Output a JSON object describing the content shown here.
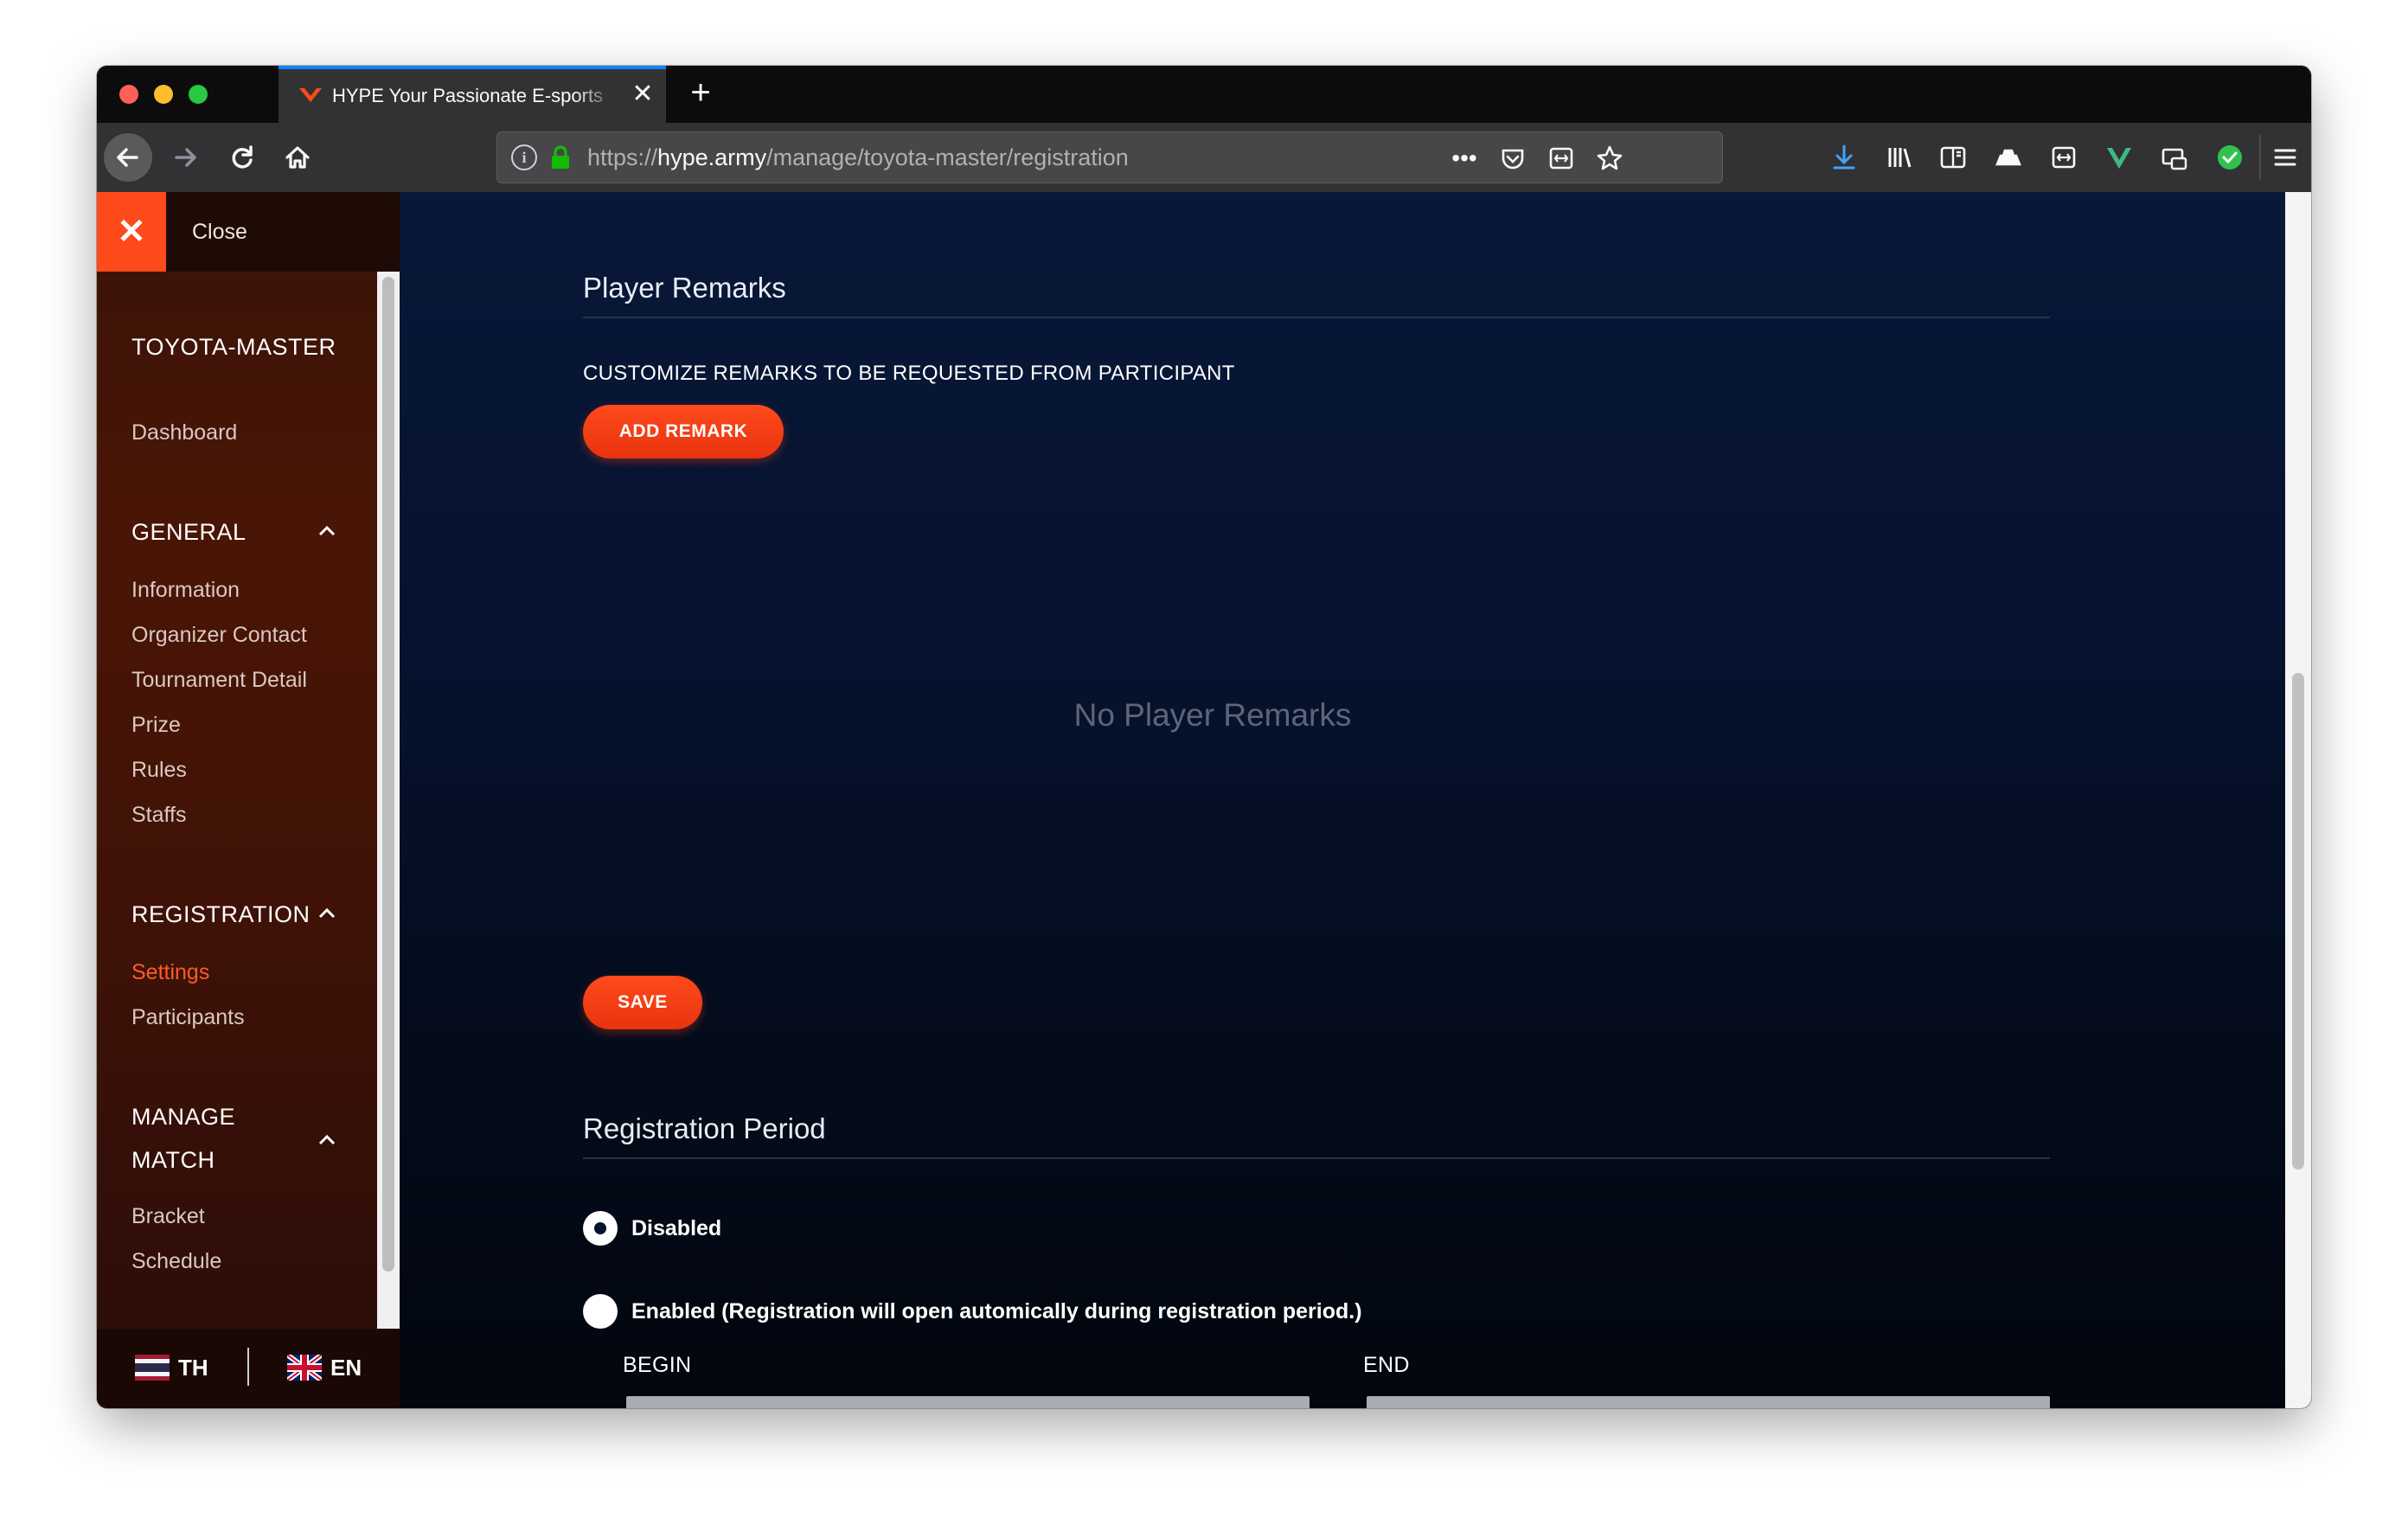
{
  "browser": {
    "tab_title": "HYPE Your Passionate E-sports",
    "url_scheme": "https://",
    "url_host": "hype.army",
    "url_path": "/manage/toyota-master/registration",
    "toolbar_icons": [
      "download-icon",
      "library-icon",
      "sidebar-icon",
      "extension-icon",
      "screenshot-icon",
      "vue-devtools-icon",
      "inbox-icon",
      "check-icon",
      "menu-icon"
    ]
  },
  "sidebar": {
    "close_label": "Close",
    "project_title": "TOYOTA-MASTER",
    "dashboard": "Dashboard",
    "general": {
      "heading": "GENERAL",
      "items": [
        "Information",
        "Organizer Contact",
        "Tournament Detail",
        "Prize",
        "Rules",
        "Staffs"
      ]
    },
    "registration": {
      "heading": "REGISTRATION",
      "items": [
        "Settings",
        "Participants"
      ],
      "active_item": "Settings"
    },
    "manage_match": {
      "heading_line1": "MANAGE",
      "heading_line2": "MATCH",
      "items": [
        "Bracket",
        "Schedule"
      ]
    },
    "languages": {
      "th": "TH",
      "en": "EN"
    }
  },
  "main": {
    "player_remarks": {
      "title": "Player Remarks",
      "instruction": "CUSTOMIZE REMARKS TO BE REQUESTED FROM PARTICIPANT",
      "add_button": "ADD REMARK",
      "empty_text": "No Player Remarks",
      "save_button": "SAVE"
    },
    "registration_period": {
      "title": "Registration Period",
      "options": [
        {
          "label": "Disabled",
          "selected": true
        },
        {
          "label": "Enabled (Registration will open automically during registration period.)",
          "selected": false
        }
      ],
      "begin_label": "BEGIN",
      "end_label": "END"
    }
  },
  "colors": {
    "accent": "#ff4a1c",
    "active_link": "#ff5a2a",
    "main_bg": "#061330",
    "sidebar_bg": "#4a1506"
  }
}
